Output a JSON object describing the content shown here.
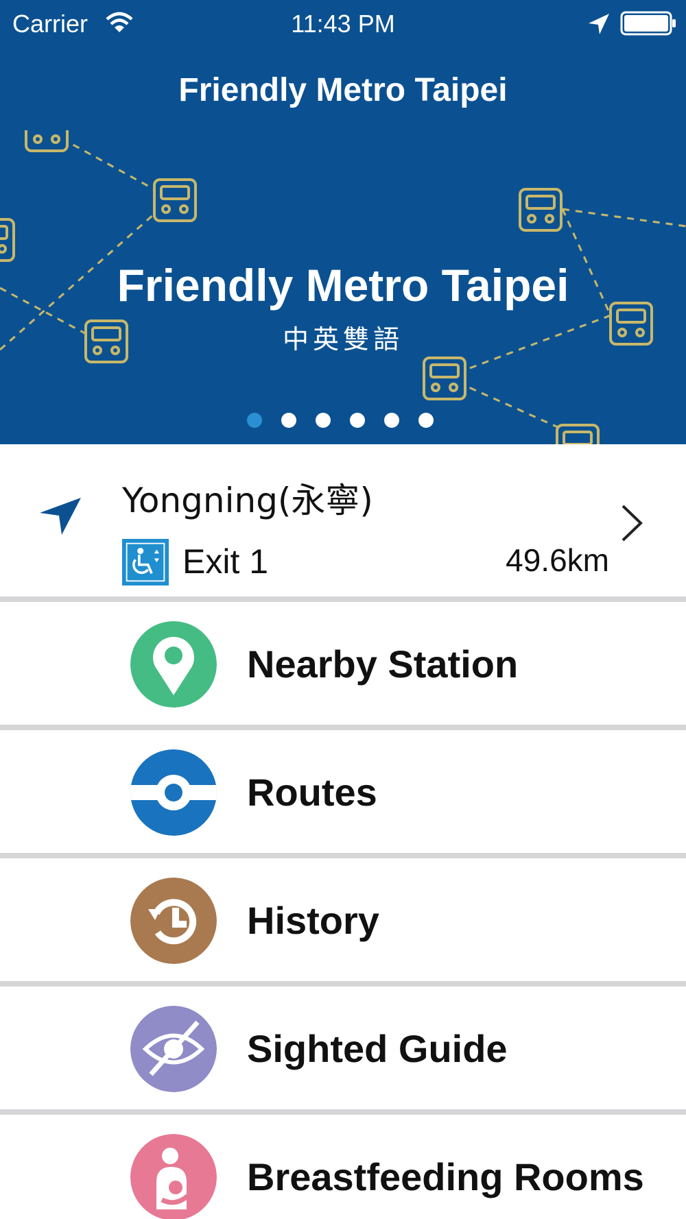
{
  "status_bar": {
    "carrier": "Carrier",
    "time": "11:43 PM",
    "icons": [
      "wifi-icon",
      "location-arrow-icon",
      "battery-icon"
    ]
  },
  "header": {
    "title": "Friendly Metro Taipei",
    "background_color": "#0b5191"
  },
  "banner": {
    "title": "Friendly Metro Taipei",
    "subtitle": "中英雙語",
    "page_count": 6,
    "active_page": 1,
    "decoration_color": "#c8b86a"
  },
  "nearest_station": {
    "name": "Yongning(永寧)",
    "exit": "Exit 1",
    "distance": "49.6km",
    "icons": [
      "navigation-arrow-icon",
      "wheelchair-elevator-icon",
      "chevron-right-icon"
    ]
  },
  "menu": {
    "items": [
      {
        "label": "Nearby Station",
        "icon": "map-pin-icon",
        "color": "#45bc83"
      },
      {
        "label": "Routes",
        "icon": "route-line-icon",
        "color": "#1a73be"
      },
      {
        "label": "History",
        "icon": "history-clock-icon",
        "color": "#a97a4f"
      },
      {
        "label": "Sighted Guide",
        "icon": "eye-slash-icon",
        "color": "#8f8cc7"
      },
      {
        "label": "Breastfeeding Rooms",
        "icon": "mother-child-icon",
        "color": "#e77994"
      }
    ]
  }
}
